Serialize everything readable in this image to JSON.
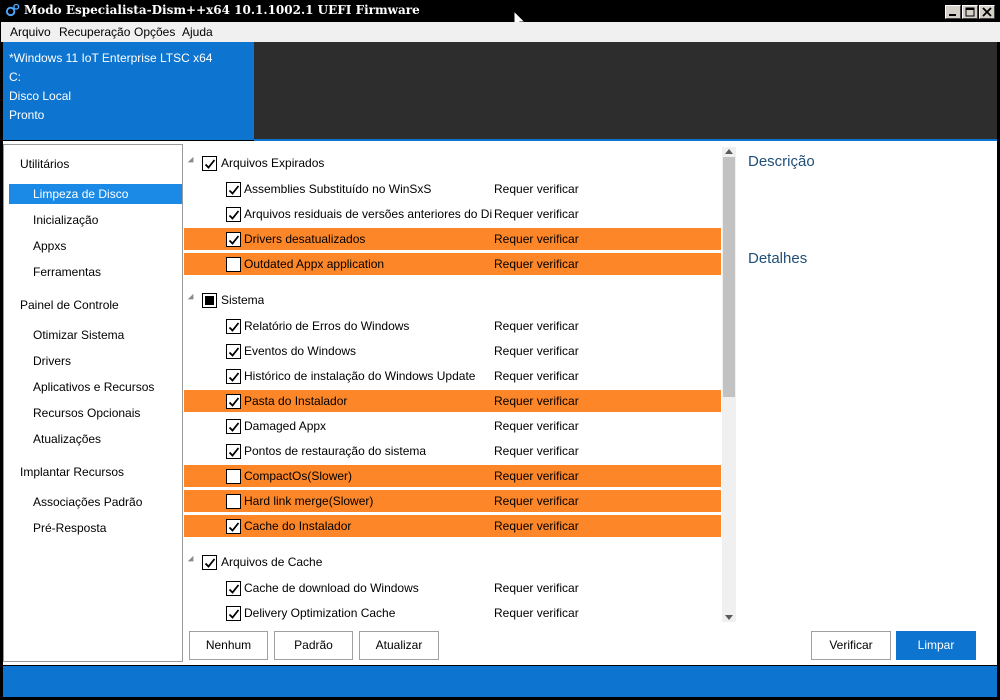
{
  "window": {
    "title": "Modo Especialista-Dism++x64 10.1.1002.1 UEFI Firmware"
  },
  "menu": [
    "Arquivo",
    "Recuperação",
    "Opções",
    "Ajuda"
  ],
  "header": {
    "lines": [
      "*Windows 11 IoT Enterprise LTSC x64",
      "C:",
      "Disco Local",
      "Pronto"
    ]
  },
  "sidebar": {
    "groups": [
      {
        "label": "Utilitários",
        "items": [
          "Limpeza de Disco",
          "Inicialização",
          "Appxs",
          "Ferramentas"
        ]
      },
      {
        "label": "Painel de Controle",
        "items": [
          "Otimizar Sistema",
          "Drivers",
          "Aplicativos e Recursos",
          "Recursos Opcionais",
          "Atualizações"
        ]
      },
      {
        "label": "Implantar Recursos",
        "items": [
          "Associações Padrão",
          "Pré-Resposta"
        ]
      }
    ],
    "active_item": "Limpeza de Disco"
  },
  "list": {
    "status_text": "Requer verificar",
    "groups": [
      {
        "label": "Arquivos Expirados",
        "state": "checked",
        "items": [
          {
            "label": "Assemblies Substituído no WinSxS",
            "checked": true,
            "highlight": false
          },
          {
            "label": "Arquivos residuais de versões anteriores do Disr",
            "checked": true,
            "highlight": false
          },
          {
            "label": "Drivers desatualizados",
            "checked": true,
            "highlight": true
          },
          {
            "label": "Outdated Appx application",
            "checked": false,
            "highlight": true
          }
        ]
      },
      {
        "label": "Sistema",
        "state": "partial",
        "items": [
          {
            "label": "Relatório de Erros do Windows",
            "checked": true,
            "highlight": false
          },
          {
            "label": "Eventos do Windows",
            "checked": true,
            "highlight": false
          },
          {
            "label": "Histórico de instalação do Windows Update",
            "checked": true,
            "highlight": false
          },
          {
            "label": "Pasta do Instalador",
            "checked": true,
            "highlight": true
          },
          {
            "label": "Damaged Appx",
            "checked": true,
            "highlight": false
          },
          {
            "label": "Pontos de restauração do sistema",
            "checked": true,
            "highlight": false
          },
          {
            "label": "CompactOs(Slower)",
            "checked": false,
            "highlight": true
          },
          {
            "label": "Hard link merge(Slower)",
            "checked": false,
            "highlight": true
          },
          {
            "label": "Cache do Instalador",
            "checked": true,
            "highlight": true
          }
        ]
      },
      {
        "label": "Arquivos de Cache",
        "state": "checked",
        "items": [
          {
            "label": "Cache de download do Windows",
            "checked": true,
            "highlight": false
          },
          {
            "label": "Delivery Optimization Cache",
            "checked": true,
            "highlight": false
          }
        ]
      }
    ]
  },
  "right_panel": {
    "description_label": "Descrição",
    "details_label": "Detalhes"
  },
  "buttons": {
    "none": "Nenhum",
    "default": "Padrão",
    "refresh": "Atualizar",
    "scan": "Verificar",
    "clean": "Limpar"
  },
  "colors": {
    "accent": "#0d74cf",
    "highlight": "#fd8629",
    "header_dark": "#2d2d2d"
  }
}
